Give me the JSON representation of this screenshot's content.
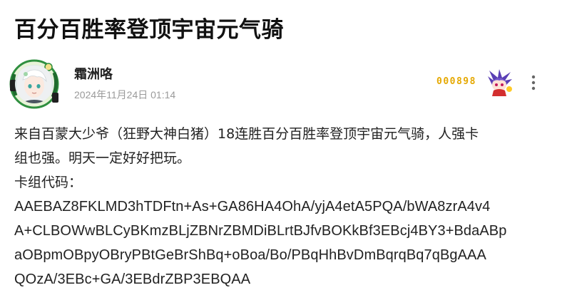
{
  "post": {
    "title": "百分百胜率登顶宇宙元气骑",
    "author": {
      "name": "霜洲咯",
      "date": "2024年11月24日 01:14"
    },
    "badge": {
      "number": "000898"
    },
    "body": {
      "line1": "来自百蒙大少爷（狂野大神白猪）18连胜百分百胜率登顶宇宙元气骑，人强卡",
      "line2": "组也强。明天一定好好把玩。",
      "line3": "卡组代码：",
      "code_lines": [
        "AAEBAZ8FKLMD3hTDFtn+As+GA86HA4OhA/yjA4etA5PQA/bWA8zrA4v4",
        "A+CLBOWwBLCyBKmzBLjZBNrZBMDiBLrtBJfvBOKkBf3EBcj4BY3+BdaABp",
        "aOBpmOBpyOBryPBtGeBrShBq+oBoa/Bo/PBqHhBvDmBqrqBq7qBgAAA",
        "QOzA/3EBc+GA/3EBdrZBP3EBQAA"
      ]
    }
  },
  "icons": {
    "more": "more-vertical-icon",
    "avatar": "avatar-illustration",
    "badge": "badge-character-icon"
  },
  "colors": {
    "badge_number": "#e5a800",
    "date": "#9a9a9a",
    "avatar_ring": "#2f8f3f"
  }
}
